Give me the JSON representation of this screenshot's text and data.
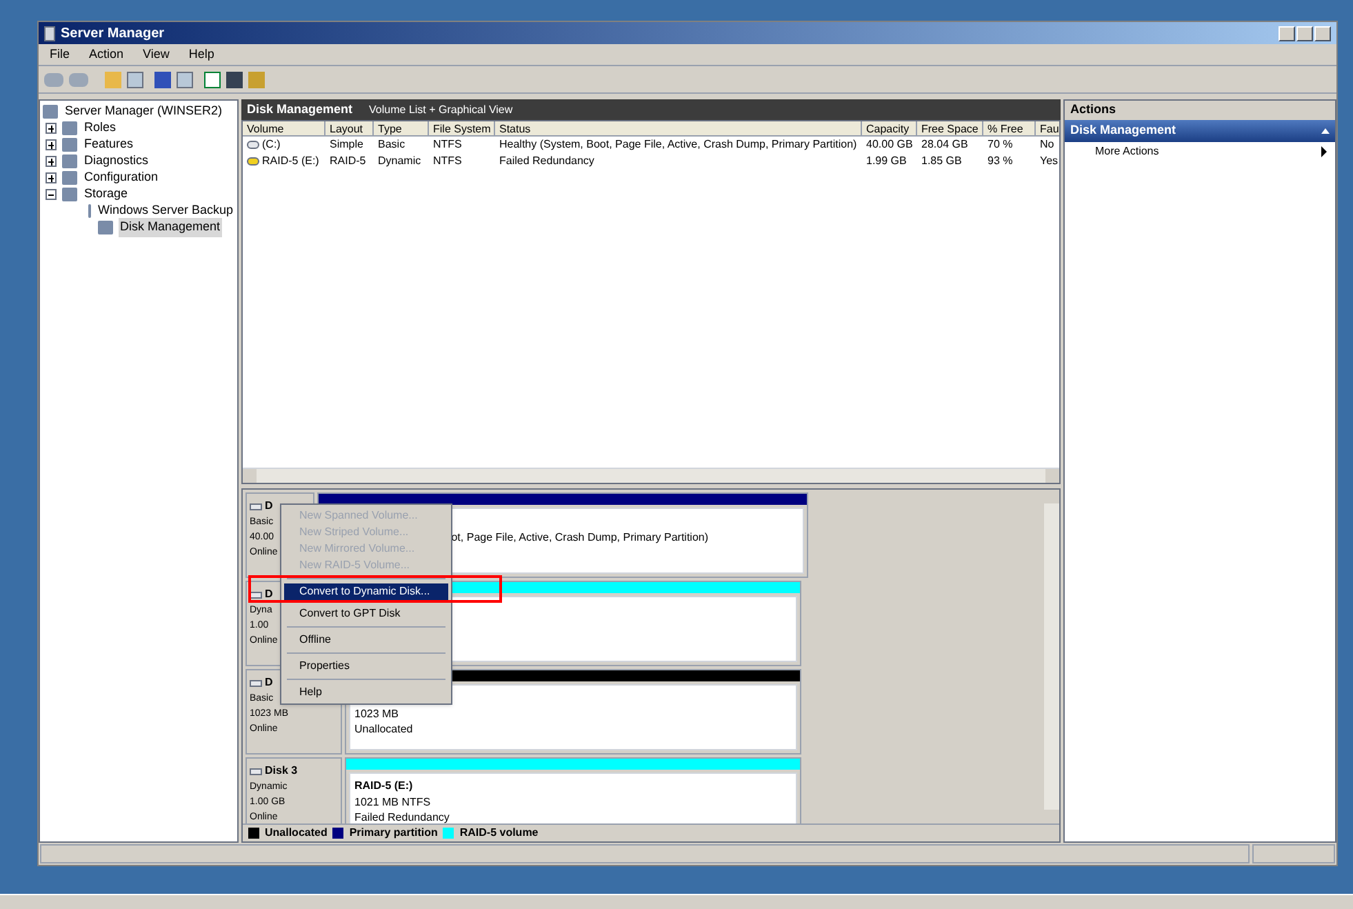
{
  "window": {
    "title": "Server Manager"
  },
  "menu_bar": [
    "File",
    "Action",
    "View",
    "Help"
  ],
  "tree": {
    "label": "Server Manager (WINSER2)",
    "selected": false,
    "children": [
      {
        "label": "Roles",
        "expanded": false,
        "selected": false
      },
      {
        "label": "Features",
        "expanded": false,
        "selected": false
      },
      {
        "label": "Diagnostics",
        "expanded": false,
        "selected": false
      },
      {
        "label": "Configuration",
        "expanded": false,
        "selected": false
      },
      {
        "label": "Storage",
        "expanded": true,
        "selected": false,
        "children": [
          {
            "label": "Windows Server Backup",
            "selected": false
          },
          {
            "label": "Disk Management",
            "selected": true
          }
        ]
      }
    ]
  },
  "center": {
    "title": "Disk Management",
    "view": "Volume List + Graphical View",
    "columns": [
      "Volume",
      "Layout",
      "Type",
      "File System",
      "Status",
      "Capacity",
      "Free Space",
      "% Free",
      "Fau"
    ],
    "rows": [
      {
        "kind": "ok",
        "cells": [
          "(C:)",
          "Simple",
          "Basic",
          "NTFS",
          "Healthy (System, Boot, Page File, Active, Crash Dump, Primary Partition)",
          "40.00 GB",
          "28.04 GB",
          "70 %",
          "No"
        ]
      },
      {
        "kind": "warning",
        "cells": [
          "RAID-5 (E:)",
          "RAID-5",
          "Dynamic",
          "NTFS",
          "Failed Redundancy",
          "1.99 GB",
          "1.85 GB",
          "93 %",
          "Yes"
        ]
      }
    ],
    "disks": [
      {
        "name": "D",
        "lines": [
          "Basic",
          "40.00",
          "Online"
        ],
        "partition": {
          "kind": "primary",
          "lines": [
            "ot, Page File, Active, Crash Dump, Primary Partition)"
          ]
        }
      },
      {
        "name": "D",
        "lines": [
          "Dyna",
          "1.00",
          "Online"
        ],
        "partition": {
          "kind": "raid5"
        }
      },
      {
        "name": "D",
        "lines": [
          "Basic",
          "1023 MB",
          "Online"
        ],
        "partition": {
          "kind": "unallocated",
          "lines": [
            "1023 MB",
            "Unallocated"
          ]
        }
      },
      {
        "name": "Disk 3",
        "lines": [
          "Dynamic",
          "1.00 GB",
          "Online"
        ],
        "partition": {
          "kind": "raid5",
          "title": "RAID-5  (E:)",
          "lines": [
            "1021 MB NTFS",
            "Failed Redundancy"
          ]
        }
      }
    ],
    "legend": [
      {
        "label": "Unallocated",
        "color": "#000000"
      },
      {
        "label": "Primary partition",
        "color": "#000080"
      },
      {
        "label": "RAID-5 volume",
        "color": "#00ffff"
      }
    ]
  },
  "context_menu": [
    {
      "kind": "item",
      "label": "New Spanned Volume...",
      "disabled": true,
      "selected": false
    },
    {
      "kind": "item",
      "label": "New Striped Volume...",
      "disabled": true,
      "selected": false
    },
    {
      "kind": "item",
      "label": "New Mirrored Volume...",
      "disabled": true,
      "selected": false
    },
    {
      "kind": "item",
      "label": "New RAID-5 Volume...",
      "disabled": true,
      "selected": false
    },
    {
      "kind": "separator"
    },
    {
      "kind": "item",
      "label": "Convert to Dynamic Disk...",
      "disabled": false,
      "selected": true
    },
    {
      "kind": "item",
      "label": "Convert to GPT Disk",
      "disabled": false,
      "selected": false
    },
    {
      "kind": "separator"
    },
    {
      "kind": "item",
      "label": "Offline",
      "disabled": false,
      "selected": false
    },
    {
      "kind": "separator"
    },
    {
      "kind": "item",
      "label": "Properties",
      "disabled": false,
      "selected": false
    },
    {
      "kind": "separator"
    },
    {
      "kind": "item",
      "label": "Help",
      "disabled": false,
      "selected": false
    }
  ],
  "actions": {
    "title": "Actions",
    "section": "Disk Management",
    "items": [
      "More Actions"
    ]
  }
}
